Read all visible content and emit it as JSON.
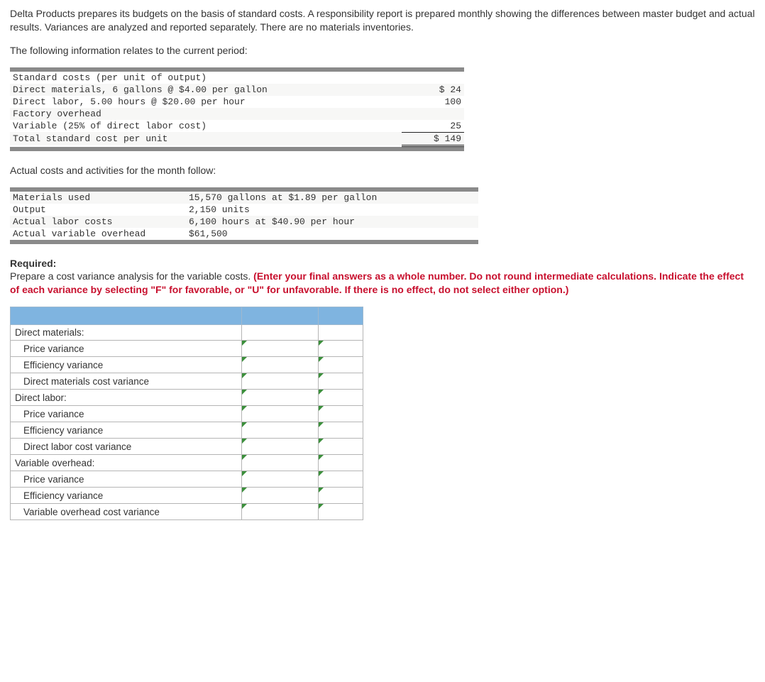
{
  "intro": {
    "p1": "Delta Products prepares its budgets on the basis of standard costs. A responsibility report is prepared monthly showing the differences between master budget and actual results. Variances are analyzed and reported separately. There are no materials inventories.",
    "p2": "The following information relates to the current period:"
  },
  "std_costs": {
    "header": "Standard costs (per unit of output)",
    "dm_label": "  Direct materials, 6 gallons @ $4.00 per gallon",
    "dm_value": "$ 24",
    "dl_label": "  Direct labor, 5.00 hours @ $20.00 per hour",
    "dl_value": "100",
    "foh_label": "Factory overhead",
    "var_label": "  Variable (25% of direct labor cost)",
    "var_value": "25",
    "total_label": "Total standard cost per unit",
    "total_value": "$ 149"
  },
  "actuals_heading": "Actual costs and activities for the month follow:",
  "actuals": {
    "mat_label": "Materials used",
    "mat_value": "15,570 gallons at $1.89 per gallon",
    "out_label": "Output",
    "out_value": " 2,150 units",
    "lab_label": "Actual labor costs",
    "lab_value": " 6,100 hours at $40.90 per hour",
    "ovh_label": "Actual variable overhead",
    "ovh_value": "$61,500"
  },
  "required": {
    "label": "Required:",
    "body": "Prepare a cost variance analysis for the variable costs. ",
    "instructions": "(Enter your final answers as a whole number. Do not round intermediate calculations. Indicate the effect of each variance by selecting \"F\" for favorable, or \"U\" for unfavorable. If there is no effect, do not select either option.)"
  },
  "answer_rows": {
    "dm_header": "Direct materials:",
    "dm_price": "Price variance",
    "dm_eff": "Efficiency variance",
    "dm_cost": "Direct materials cost variance",
    "dl_header": "Direct labor:",
    "dl_price": "Price variance",
    "dl_eff": "Efficiency variance",
    "dl_cost": "Direct labor cost variance",
    "vo_header": "Variable overhead:",
    "vo_price": "Price variance",
    "vo_eff": "Efficiency variance",
    "vo_cost": "Variable overhead cost variance"
  }
}
